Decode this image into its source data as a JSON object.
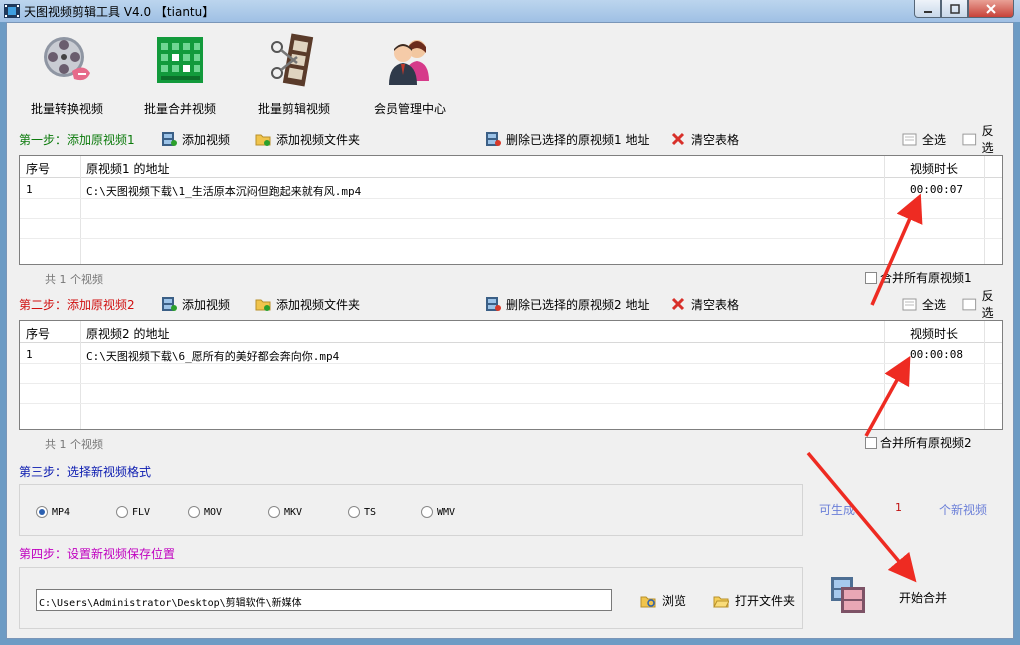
{
  "window": {
    "title": "天图视频剪辑工具 V4.0 【tiantu】"
  },
  "toolbar": {
    "items": [
      {
        "label": "批量转换视频",
        "icon": "film-reel-icon"
      },
      {
        "label": "批量合并视频",
        "icon": "merge-grid-icon"
      },
      {
        "label": "批量剪辑视频",
        "icon": "film-scissors-icon"
      },
      {
        "label": "会员管理中心",
        "icon": "members-icon"
      }
    ]
  },
  "step1": {
    "title": "第一步：添加原视频1",
    "add_video": "添加视频",
    "add_folder": "添加视频文件夹",
    "delete_selected": "删除已选择的原视频1 地址",
    "clear_table": "清空表格",
    "select_all": "全选",
    "invert": "反选",
    "columns": {
      "index": "序号",
      "path": "原视频1 的地址",
      "duration": "视频时长"
    },
    "rows": [
      {
        "index": "1",
        "path": "C:\\天图视频下载\\1_生活原本沉闷但跑起来就有风.mp4",
        "duration": "00:00:07"
      }
    ],
    "count_prefix": "共",
    "count_value": "1",
    "count_suffix": "个视频",
    "merge_all": "合并所有原视频1"
  },
  "step2": {
    "title": "第二步：添加原视频2",
    "add_video": "添加视频",
    "add_folder": "添加视频文件夹",
    "delete_selected": "删除已选择的原视频2 地址",
    "clear_table": "清空表格",
    "select_all": "全选",
    "invert": "反选",
    "columns": {
      "index": "序号",
      "path": "原视频2 的地址",
      "duration": "视频时长"
    },
    "rows": [
      {
        "index": "1",
        "path": "C:\\天图视频下载\\6_愿所有的美好都会奔向你.mp4",
        "duration": "00:00:08"
      }
    ],
    "count_prefix": "共",
    "count_value": "1",
    "count_suffix": "个视频",
    "merge_all": "合并所有原视频2"
  },
  "step3": {
    "title": "第三步：选择新视频格式",
    "formats": [
      "MP4",
      "FLV",
      "MOV",
      "MKV",
      "TS",
      "WMV"
    ],
    "selected_format": "MP4",
    "gen_prefix": "可生成",
    "gen_count": "1",
    "gen_suffix": "个新视频"
  },
  "step4": {
    "title": "第四步：设置新视频保存位置",
    "path": "C:\\Users\\Administrator\\Desktop\\剪辑软件\\新媒体",
    "browse": "浏览",
    "open_folder": "打开文件夹",
    "start": "开始合并"
  },
  "colors": {
    "accent_arrow": "#ee2b22",
    "step1": "#0b7a0b",
    "step2": "#d01010",
    "step3": "#0a1ab0",
    "step4": "#c000c0"
  }
}
